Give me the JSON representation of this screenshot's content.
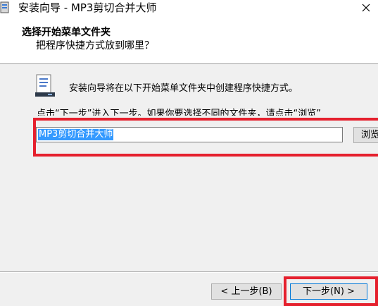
{
  "window": {
    "title": "安装向导 - MP3剪切合并大师"
  },
  "header": {
    "title": "选择开始菜单文件夹",
    "subtitle": "把程序快捷方式放到哪里？"
  },
  "content": {
    "info": "安装向导将在以下开始菜单文件夹中创建程序快捷方式。",
    "hint": "点击“下一步”进入下一步。如果你要选择不同的文件夹，请点击“浏览”",
    "folder_value": "MP3剪切合并大师",
    "browse_label": "浏览"
  },
  "footer": {
    "back_label": "< 上一步(B)",
    "next_label": "下一步(N) >"
  },
  "colors": {
    "highlight": "#e5202d",
    "selection": "#3399ff"
  }
}
